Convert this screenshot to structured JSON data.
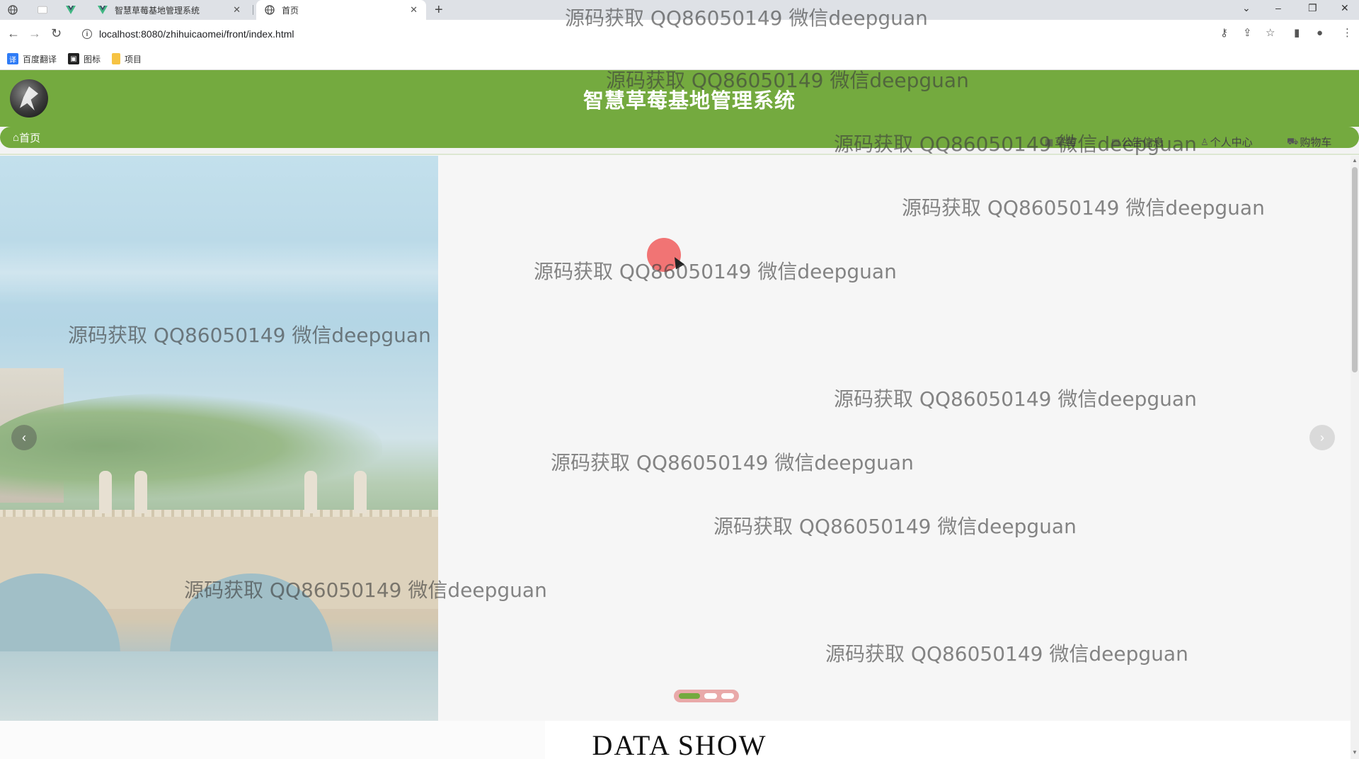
{
  "browser": {
    "tabs": [
      {
        "title": "",
        "icon": "globe-icon"
      },
      {
        "title": "",
        "icon": "blank-page-icon"
      },
      {
        "title": "",
        "icon": "vue-logo-icon"
      },
      {
        "title": "智慧草莓基地管理系统",
        "icon": "vue-logo-icon"
      },
      {
        "title": "首页",
        "icon": "globe-icon",
        "active": true
      }
    ],
    "url": "localhost:8080/zhihuicaomei/front/index.html",
    "bookmarks": [
      {
        "label": "百度翻译",
        "icon": "translate-icon",
        "color": "#2f7cf6"
      },
      {
        "label": "图标",
        "icon": "image-icon",
        "color": "#222222"
      },
      {
        "label": "项目",
        "icon": "folder-icon",
        "color": "#f6c343"
      }
    ]
  },
  "site": {
    "title": "智慧草莓基地管理系统",
    "header_color": "#74aa3f",
    "nav": [
      {
        "label": "首页",
        "icon": "home-icon",
        "active": true
      },
      {
        "label": "草莓",
        "icon": "grid-icon"
      },
      {
        "label": "公告信息",
        "icon": "document-icon"
      },
      {
        "label": "个人中心",
        "icon": "user-icon"
      },
      {
        "label": "购物车",
        "icon": "cart-icon"
      }
    ],
    "carousel": {
      "slide_count": 3,
      "active_index": 0
    },
    "section_title": "DATA SHOW"
  },
  "watermark": "源码获取 QQ86050149 微信deepguan"
}
